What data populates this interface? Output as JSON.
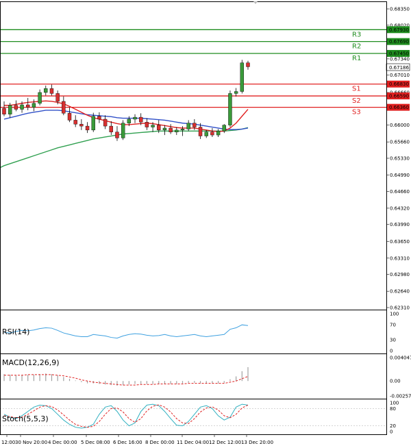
{
  "chart_data": {
    "type": "candlestick",
    "colors": {
      "up": "#3a9a3a",
      "down": "#d83030",
      "resistance": "#1e8c1e",
      "support": "#e02020",
      "ma_fast": "#e02020",
      "ma_mid": "#3050c8",
      "ma_slow": "#30a050",
      "rsi": "#3da0e0",
      "macd_hist": "#a0a0a0",
      "macd_signal": "#e02020",
      "stoch_k": "#30b0c0",
      "stoch_d": "#e02020",
      "grid": "#dddddd",
      "frame": "#000000"
    },
    "price_ticks": [
      "0.68350",
      "0.68020",
      "0.67340",
      "0.67010",
      "0.66660",
      "0.66000",
      "0.65660",
      "0.65330",
      "0.64990",
      "0.64660",
      "0.64320",
      "0.63990",
      "0.63650",
      "0.63310",
      "0.62980",
      "0.62640",
      "0.62310"
    ],
    "price_axis": {
      "min": 0.6231,
      "max": 0.6835
    },
    "current_price": "0.67186",
    "levels": [
      {
        "name": "R3",
        "value": "0.67930",
        "type": "resistance"
      },
      {
        "name": "R2",
        "value": "0.67690",
        "type": "resistance"
      },
      {
        "name": "R1",
        "value": "0.67450",
        "type": "resistance"
      },
      {
        "name": "S1",
        "value": "0.66830",
        "type": "support"
      },
      {
        "name": "S2",
        "value": "0.66590",
        "type": "support"
      },
      {
        "name": "S3",
        "value": "0.66360",
        "type": "support"
      }
    ],
    "candles": [
      [
        0.6634,
        0.6648,
        0.6618,
        0.6622
      ],
      [
        0.6622,
        0.6645,
        0.6615,
        0.664
      ],
      [
        0.664,
        0.665,
        0.6628,
        0.6632
      ],
      [
        0.6632,
        0.6648,
        0.6625,
        0.6641
      ],
      [
        0.6641,
        0.6655,
        0.663,
        0.6636
      ],
      [
        0.6636,
        0.6652,
        0.6628,
        0.6644
      ],
      [
        0.6644,
        0.6672,
        0.664,
        0.6666
      ],
      [
        0.6666,
        0.668,
        0.666,
        0.6674
      ],
      [
        0.6674,
        0.6682,
        0.666,
        0.6664
      ],
      [
        0.6664,
        0.667,
        0.6642,
        0.6648
      ],
      [
        0.6648,
        0.6658,
        0.662,
        0.6624
      ],
      [
        0.6624,
        0.6636,
        0.6606,
        0.661
      ],
      [
        0.661,
        0.662,
        0.6596,
        0.6602
      ],
      [
        0.6602,
        0.6612,
        0.659,
        0.6598
      ],
      [
        0.6598,
        0.6606,
        0.6584,
        0.659
      ],
      [
        0.659,
        0.6625,
        0.6586,
        0.6618
      ],
      [
        0.6618,
        0.6626,
        0.6604,
        0.6612
      ],
      [
        0.6612,
        0.662,
        0.6592,
        0.6598
      ],
      [
        0.6598,
        0.6608,
        0.658,
        0.6586
      ],
      [
        0.6586,
        0.6598,
        0.6568,
        0.6574
      ],
      [
        0.6574,
        0.661,
        0.657,
        0.6604
      ],
      [
        0.6604,
        0.6618,
        0.6598,
        0.6612
      ],
      [
        0.6612,
        0.6622,
        0.6604,
        0.6616
      ],
      [
        0.6616,
        0.6624,
        0.66,
        0.6606
      ],
      [
        0.6606,
        0.6614,
        0.659,
        0.6596
      ],
      [
        0.6596,
        0.6606,
        0.6586,
        0.66
      ],
      [
        0.66,
        0.661,
        0.6584,
        0.659
      ],
      [
        0.659,
        0.66,
        0.658,
        0.6594
      ],
      [
        0.6594,
        0.6602,
        0.6582,
        0.6586
      ],
      [
        0.6586,
        0.6596,
        0.658,
        0.659
      ],
      [
        0.659,
        0.6598,
        0.6578,
        0.6592
      ],
      [
        0.6592,
        0.661,
        0.6588,
        0.6604
      ],
      [
        0.6604,
        0.6612,
        0.659,
        0.6596
      ],
      [
        0.6596,
        0.6604,
        0.6572,
        0.6578
      ],
      [
        0.6578,
        0.659,
        0.6574,
        0.6586
      ],
      [
        0.6586,
        0.6594,
        0.6576,
        0.658
      ],
      [
        0.658,
        0.6592,
        0.6576,
        0.6588
      ],
      [
        0.6588,
        0.6602,
        0.6584,
        0.66
      ],
      [
        0.66,
        0.667,
        0.6596,
        0.6664
      ],
      [
        0.6664,
        0.6675,
        0.6658,
        0.6668
      ],
      [
        0.6668,
        0.6732,
        0.6664,
        0.6726
      ],
      [
        0.6726,
        0.673,
        0.6712,
        0.6718
      ]
    ],
    "ma": {
      "fast": [
        0.664,
        0.664,
        0.6642,
        0.6644,
        0.6646,
        0.6647,
        0.6648,
        0.6649,
        0.6648,
        0.6646,
        0.6643,
        0.6638,
        0.6632,
        0.6626,
        0.662,
        0.6615,
        0.6612,
        0.6609,
        0.6606,
        0.6603,
        0.6601,
        0.6601,
        0.6602,
        0.6603,
        0.6604,
        0.6603,
        0.6601,
        0.6599,
        0.6597,
        0.6595,
        0.6594,
        0.6594,
        0.6594,
        0.6592,
        0.659,
        0.6588,
        0.6587,
        0.6588,
        0.6594,
        0.6604,
        0.6618,
        0.6632
      ],
      "mid": [
        0.6612,
        0.6615,
        0.6618,
        0.6621,
        0.6624,
        0.6626,
        0.6628,
        0.663,
        0.663,
        0.663,
        0.6629,
        0.6627,
        0.6625,
        0.6623,
        0.6621,
        0.662,
        0.6619,
        0.6618,
        0.6617,
        0.6615,
        0.6614,
        0.6614,
        0.6614,
        0.6614,
        0.6613,
        0.6612,
        0.6611,
        0.661,
        0.6608,
        0.6606,
        0.6604,
        0.6603,
        0.6602,
        0.66,
        0.6598,
        0.6596,
        0.6594,
        0.6592,
        0.6591,
        0.6591,
        0.6592,
        0.6594
      ],
      "slow": [
        0.6518,
        0.6522,
        0.6526,
        0.653,
        0.6534,
        0.6538,
        0.6542,
        0.6546,
        0.655,
        0.6554,
        0.6557,
        0.656,
        0.6563,
        0.6566,
        0.6569,
        0.6572,
        0.6574,
        0.6576,
        0.6578,
        0.658,
        0.6582,
        0.6583,
        0.6584,
        0.6585,
        0.6586,
        0.6587,
        0.6588,
        0.6588,
        0.6588,
        0.6588,
        0.6588,
        0.6588,
        0.6588,
        0.6588,
        0.6588,
        0.6588,
        0.6588,
        0.6588,
        0.6589,
        0.659,
        0.6592,
        0.6595
      ]
    },
    "rsi": {
      "label": "RSI(14)",
      "ticks": [
        "100",
        "70",
        "30",
        "0"
      ],
      "values": [
        50,
        48,
        52,
        55,
        54,
        56,
        60,
        62,
        61,
        55,
        48,
        44,
        40,
        38,
        38,
        44,
        42,
        40,
        36,
        34,
        40,
        44,
        46,
        45,
        42,
        40,
        41,
        44,
        40,
        38,
        40,
        42,
        44,
        40,
        38,
        40,
        42,
        44,
        58,
        62,
        70,
        68
      ]
    },
    "macd": {
      "label": "MACD(12,26,9)",
      "ticks": [
        "0.004047",
        "0.00",
        "-0.002573"
      ],
      "hist": [
        0.0012,
        0.0011,
        0.001,
        0.001,
        0.0011,
        0.0011,
        0.0012,
        0.0013,
        0.0012,
        0.001,
        0.0007,
        0.0004,
        0.0001,
        -0.0002,
        -0.0004,
        -0.0004,
        -0.0005,
        -0.0006,
        -0.0007,
        -0.0008,
        -0.0007,
        -0.0006,
        -0.0005,
        -0.0005,
        -0.0005,
        -0.0005,
        -0.0005,
        -0.0005,
        -0.0005,
        -0.0005,
        -0.0004,
        -0.0003,
        -0.0003,
        -0.0004,
        -0.0004,
        -0.0004,
        -0.0004,
        -0.0003,
        0.0003,
        0.0008,
        0.0017,
        0.0024
      ],
      "signal": [
        0.001,
        0.001,
        0.001,
        0.001,
        0.0011,
        0.0011,
        0.0011,
        0.0011,
        0.0011,
        0.001,
        0.0009,
        0.0007,
        0.0005,
        0.0002,
        0.0,
        -0.0002,
        -0.0003,
        -0.0004,
        -0.0005,
        -0.0006,
        -0.0007,
        -0.0007,
        -0.0007,
        -0.0006,
        -0.0006,
        -0.0006,
        -0.0005,
        -0.0005,
        -0.0005,
        -0.0005,
        -0.0005,
        -0.0004,
        -0.0004,
        -0.0004,
        -0.0004,
        -0.0004,
        -0.0004,
        -0.0004,
        -0.0002,
        0.0,
        0.0004,
        0.0008
      ]
    },
    "stoch": {
      "label": "Stoch(5,5,3)",
      "ticks": [
        "100",
        "80",
        "20",
        "0"
      ],
      "k": [
        60,
        50,
        45,
        55,
        70,
        85,
        92,
        90,
        80,
        60,
        40,
        25,
        15,
        12,
        15,
        25,
        60,
        85,
        90,
        70,
        40,
        20,
        30,
        70,
        92,
        95,
        90,
        70,
        45,
        22,
        20,
        35,
        60,
        85,
        90,
        80,
        55,
        40,
        50,
        85,
        95,
        92
      ],
      "d": [
        55,
        52,
        48,
        50,
        60,
        72,
        85,
        90,
        87,
        75,
        58,
        40,
        25,
        18,
        15,
        18,
        35,
        60,
        80,
        82,
        68,
        45,
        32,
        45,
        72,
        88,
        93,
        85,
        68,
        45,
        30,
        28,
        45,
        68,
        82,
        86,
        75,
        55,
        48,
        60,
        82,
        92
      ]
    },
    "x_ticks": [
      "12:00",
      "30 Nov 20:00",
      "4 Dec 00:00",
      "5 Dec 08:00",
      "6 Dec 16:00",
      "8 Dec 00:00",
      "11 Dec 04:00",
      "12 Dec 12:00",
      "13 Dec 20:00"
    ]
  }
}
